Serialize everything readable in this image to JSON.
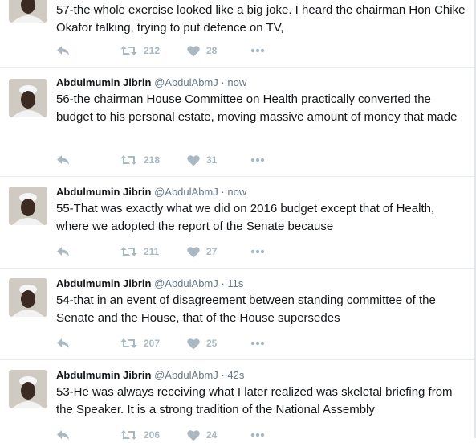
{
  "tweets": [
    {
      "name": "",
      "handle": "",
      "time": "",
      "text": "57-the whole exercise looked like a big joke. I heard the chairman Hon Chike Okafor talking, trying to put defence on TV,",
      "retweets": "212",
      "likes": "28"
    },
    {
      "name": "Abdulmumin Jibrin",
      "handle": "@AbdulAbmJ",
      "time": "now",
      "text": "56-the chairman House Committee on Health practically converted the budget to his personal estate, moving massive amount of money that made",
      "retweets": "218",
      "likes": "31"
    },
    {
      "name": "Abdulmumin Jibrin",
      "handle": "@AbdulAbmJ",
      "time": "now",
      "text": "55-That was exactly what we did on 2016 budget except that of Health, where we adopted the report of the Senate because",
      "retweets": "211",
      "likes": "27"
    },
    {
      "name": "Abdulmumin Jibrin",
      "handle": "@AbdulAbmJ",
      "time": "11s",
      "text": "54-that in an event of disagreement between standing committee of the Senate and the House, that of the House supersedes",
      "retweets": "207",
      "likes": "25"
    },
    {
      "name": "Abdulmumin Jibrin",
      "handle": "@AbdulAbmJ",
      "time": "42s",
      "text": "53-He was always receiving what I later realized was skeletal briefing from the Speaker. It is a strong tradition of the National Assembly",
      "retweets": "206",
      "likes": "24"
    }
  ],
  "icons": {
    "reply": "reply-icon",
    "retweet": "retweet-icon",
    "like": "heart-icon",
    "more": "more-icon"
  },
  "colors": {
    "text": "#14171a",
    "meta": "#657786",
    "action": "#aab8c2",
    "divider": "#e6ecf0"
  }
}
